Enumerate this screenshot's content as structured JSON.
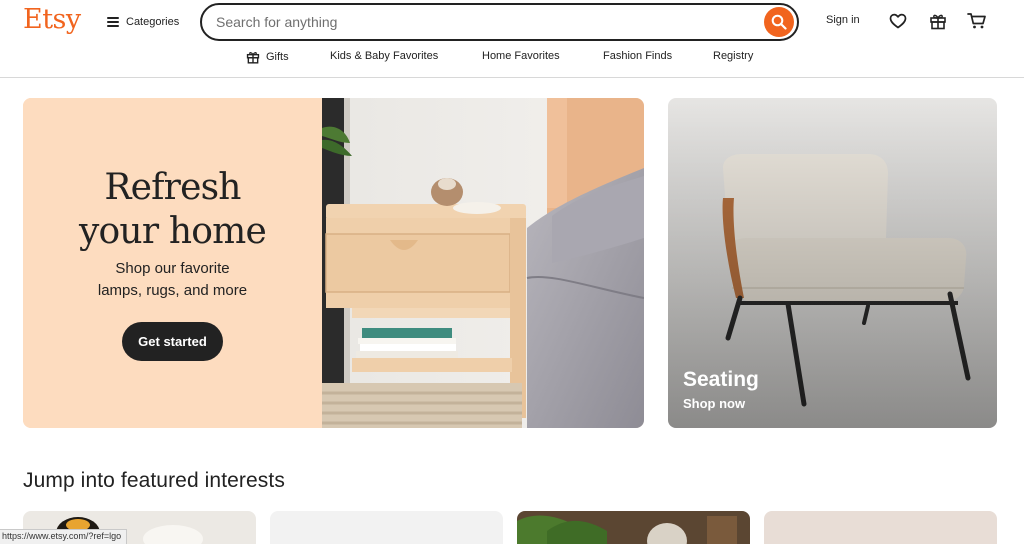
{
  "header": {
    "logo": "Etsy",
    "categories_label": "Categories",
    "search_placeholder": "Search for anything",
    "search_value": "",
    "sign_in_label": "Sign in"
  },
  "nav": {
    "items": [
      {
        "label": "Gifts",
        "icon": "gift-icon"
      },
      {
        "label": "Kids & Baby Favorites"
      },
      {
        "label": "Home Favorites"
      },
      {
        "label": "Fashion Finds"
      },
      {
        "label": "Registry"
      }
    ]
  },
  "hero": {
    "title_line1": "Refresh",
    "title_line2": "your home",
    "subtitle_line1": "Shop our favorite",
    "subtitle_line2": "lamps, rugs, and more",
    "button_label": "Get started"
  },
  "seating_card": {
    "title": "Seating",
    "link_label": "Shop now"
  },
  "featured": {
    "title": "Jump into featured interests"
  },
  "status_bar": {
    "url": "https://www.etsy.com/?ref=lgo"
  },
  "colors": {
    "brand": "#f1641e",
    "hero_bg": "#fddcbf",
    "button_dark": "#222222"
  }
}
